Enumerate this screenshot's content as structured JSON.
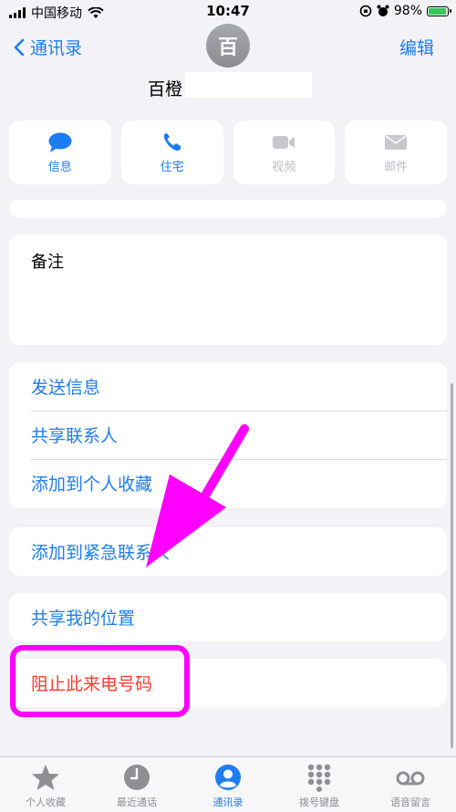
{
  "status_bar": {
    "carrier": "中国移动",
    "time": "10:47",
    "battery_percent": "98%",
    "battery_level": 0.98
  },
  "header": {
    "back_label": "通讯录",
    "edit_label": "编辑",
    "avatar_initial": "百",
    "contact_name": "百橙"
  },
  "actions": [
    {
      "label": "信息",
      "icon": "message-bubble-icon",
      "enabled": true
    },
    {
      "label": "住宅",
      "icon": "phone-icon",
      "enabled": true
    },
    {
      "label": "视频",
      "icon": "video-camera-icon",
      "enabled": false
    },
    {
      "label": "邮件",
      "icon": "mail-envelope-icon",
      "enabled": false
    }
  ],
  "notes": {
    "label": "备注"
  },
  "list_groups": {
    "group1": [
      "发送信息",
      "共享联系人",
      "添加到个人收藏"
    ],
    "group2": [
      "添加到紧急联系人"
    ],
    "group3": [
      "共享我的位置"
    ],
    "group4": [
      "阻止此来电号码"
    ]
  },
  "tab_bar": {
    "tabs": [
      {
        "label": "个人收藏",
        "icon": "star-icon",
        "active": false
      },
      {
        "label": "最近通话",
        "icon": "clock-icon",
        "active": false
      },
      {
        "label": "通讯录",
        "icon": "person-circle-icon",
        "active": true
      },
      {
        "label": "拨号键盘",
        "icon": "keypad-icon",
        "active": false
      },
      {
        "label": "语音留言",
        "icon": "voicemail-icon",
        "active": false
      }
    ]
  },
  "colors": {
    "accent": "#1e7cf2",
    "destructive": "#ff3b30",
    "annotation": "#ff00ff",
    "background": "#f2f2f7"
  }
}
